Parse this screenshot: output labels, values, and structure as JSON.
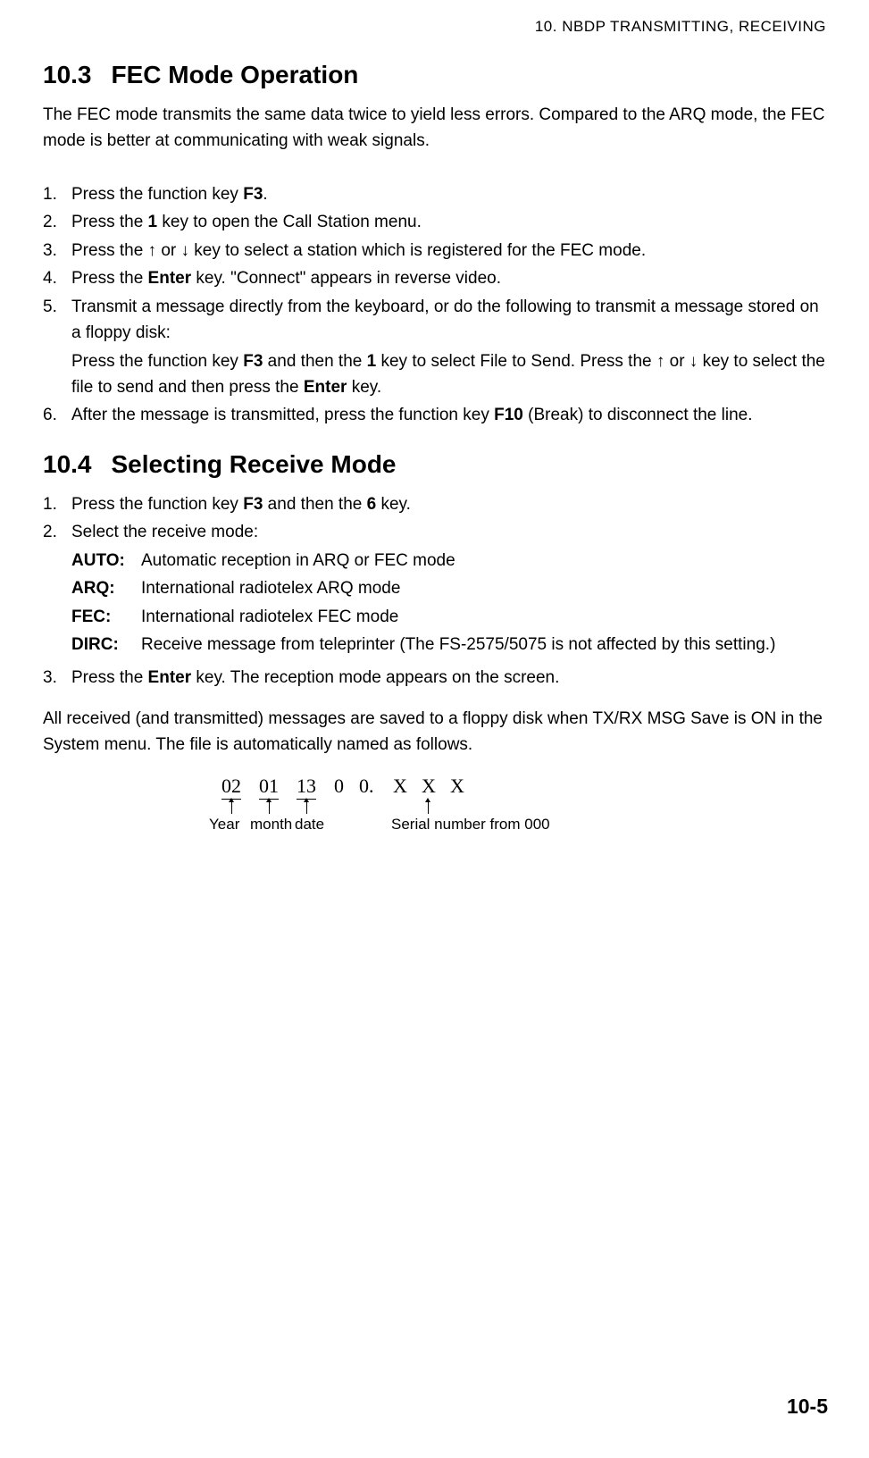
{
  "header": {
    "chapter": "10.  NBDP  TRANSMITTING,  RECEIVING"
  },
  "section103": {
    "number": "10.3",
    "title": "FEC Mode Operation",
    "intro": "The FEC mode transmits the same data twice to yield less errors. Compared to the ARQ mode, the FEC mode is better at communicating with weak signals.",
    "steps": {
      "s1_pre": "Press the function key ",
      "s1_b1": "F3",
      "s1_post": ".",
      "s2_pre": "Press the ",
      "s2_b1": "1",
      "s2_post": " key to open the Call Station menu.",
      "s3": "Press the ↑ or ↓ key to select a station which is registered for the FEC mode.",
      "s4_pre": "Press the ",
      "s4_b1": "Enter",
      "s4_post": " key. \"Connect\" appears in reverse video.",
      "s5_main": "Transmit a message directly from the keyboard, or do the following to transmit a message stored on a floppy disk:",
      "s5_sub_pre": "Press the function key ",
      "s5_sub_b1": "F3",
      "s5_sub_mid1": " and then the ",
      "s5_sub_b2": "1",
      "s5_sub_mid2": " key to select File to Send. Press the ↑ or ↓ key to select the file to send and then press the ",
      "s5_sub_b3": "Enter",
      "s5_sub_post": " key.",
      "s6_pre": "After the message is transmitted, press the function key ",
      "s6_b1": "F10",
      "s6_post": " (Break) to disconnect the line."
    }
  },
  "section104": {
    "number": "10.4",
    "title": "Selecting Receive Mode",
    "steps": {
      "s1_pre": "Press the function key ",
      "s1_b1": "F3",
      "s1_mid": " and then the ",
      "s1_b2": "6",
      "s1_post": " key.",
      "s2_main": "Select the receive mode:",
      "modes": {
        "auto_label": "AUTO:",
        "auto_desc": "Automatic reception in ARQ or FEC mode",
        "arq_label": "ARQ:",
        "arq_desc": "International radiotelex ARQ mode",
        "fec_label": "FEC:",
        "fec_desc": "International radiotelex FEC mode",
        "dirc_label": "DIRC:",
        "dirc_desc": "Receive message from teleprinter (The FS-2575/5075 is not affected by this setting.)"
      },
      "s3_pre": "Press the ",
      "s3_b1": "Enter",
      "s3_post": " key. The reception mode appears on the screen."
    },
    "save_para": "All received (and transmitted) messages are saved to a floppy disk when TX/RX MSG Save is ON in the System menu. The file is automatically named as follows.",
    "filename": {
      "seg_year": "02",
      "seg_month": "01",
      "seg_date": "13",
      "seg_zero1": "0",
      "seg_zero2dot": "0.",
      "seg_x1": "X",
      "seg_x2": "X",
      "seg_x3": "X",
      "label_year": "Year",
      "label_month": "month",
      "label_date": "date",
      "label_serial": "Serial number from 000"
    }
  },
  "page_number": "10-5"
}
